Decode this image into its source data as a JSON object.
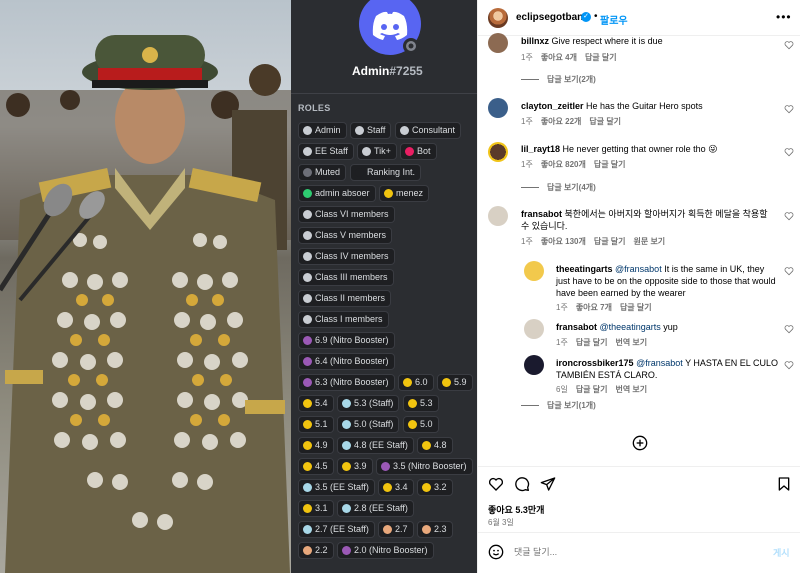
{
  "discord": {
    "username": "Admin",
    "discriminator": "#7255",
    "roles_title": "ROLES",
    "roles": [
      {
        "label": "Admin",
        "color": "#c9cdd3"
      },
      {
        "label": "Staff",
        "color": "#c9cdd3"
      },
      {
        "label": "Consultant",
        "color": "#c9cdd3"
      },
      {
        "label": "EE Staff",
        "color": "#c9cdd3"
      },
      {
        "label": "Tik+",
        "color": "#c9cdd3"
      },
      {
        "label": "Bot",
        "color": "#e91e63"
      },
      {
        "label": "Muted",
        "color": "#6d6f78"
      },
      {
        "label": "Ranking Int.",
        "color": "#1e1f22"
      },
      {
        "label": "admin absoer",
        "color": "#2ecc71"
      },
      {
        "label": "menez",
        "color": "#f1c40f"
      },
      {
        "label": "Class VI members",
        "color": "#c9cdd3"
      },
      {
        "label": "Class V members",
        "color": "#c9cdd3"
      },
      {
        "label": "Class IV members",
        "color": "#c9cdd3"
      },
      {
        "label": "Class III members",
        "color": "#c9cdd3"
      },
      {
        "label": "Class II members",
        "color": "#c9cdd3"
      },
      {
        "label": "Class I members",
        "color": "#c9cdd3"
      },
      {
        "label": "6.9 (Nitro Booster)",
        "color": "#9b59b6"
      },
      {
        "label": "6.4 (Nitro Booster)",
        "color": "#9b59b6"
      },
      {
        "label": "6.3 (Nitro Booster)",
        "color": "#9b59b6"
      },
      {
        "label": "6.0",
        "color": "#f1c40f"
      },
      {
        "label": "5.9",
        "color": "#f1c40f"
      },
      {
        "label": "5.4",
        "color": "#f1c40f"
      },
      {
        "label": "5.3 (Staff)",
        "color": "#a8d8e8"
      },
      {
        "label": "5.3",
        "color": "#f1c40f"
      },
      {
        "label": "5.1",
        "color": "#f1c40f"
      },
      {
        "label": "5.0 (Staff)",
        "color": "#a8d8e8"
      },
      {
        "label": "5.0",
        "color": "#f1c40f"
      },
      {
        "label": "4.9",
        "color": "#f1c40f"
      },
      {
        "label": "4.8 (EE Staff)",
        "color": "#a8d8e8"
      },
      {
        "label": "4.8",
        "color": "#f1c40f"
      },
      {
        "label": "4.5",
        "color": "#f1c40f"
      },
      {
        "label": "3.9",
        "color": "#f1c40f"
      },
      {
        "label": "3.5 (Nitro Booster)",
        "color": "#9b59b6"
      },
      {
        "label": "3.5 (EE Staff)",
        "color": "#a8d8e8"
      },
      {
        "label": "3.4",
        "color": "#f1c40f"
      },
      {
        "label": "3.2",
        "color": "#f1c40f"
      },
      {
        "label": "3.1",
        "color": "#f1c40f"
      },
      {
        "label": "2.8 (EE Staff)",
        "color": "#a8d8e8"
      },
      {
        "label": "2.7 (EE Staff)",
        "color": "#a8d8e8"
      },
      {
        "label": "2.7",
        "color": "#e8a87c"
      },
      {
        "label": "2.3",
        "color": "#e8a87c"
      },
      {
        "label": "2.2",
        "color": "#e8a87c"
      },
      {
        "label": "2.0 (Nitro Booster)",
        "color": "#9b59b6"
      }
    ]
  },
  "post": {
    "username": "eclipsegotban",
    "follow_label": "팔로우",
    "more_icon": "more-horizontal-icon"
  },
  "comments": [
    {
      "user": "billnxz",
      "text": "Give respect where it is due",
      "time": "1주",
      "likes": "좋아요 4개",
      "reply": "답글 달기",
      "view_replies": "답글 보기(2개)"
    },
    {
      "user": "clayton_zeitler",
      "text": "He has the Guitar Hero spots",
      "time": "1주",
      "likes": "좋아요 22개",
      "reply": "답글 달기"
    },
    {
      "user": "lil_rayt18",
      "text": "He never getting that owner role tho 😜",
      "time": "1주",
      "likes": "좋아요 820개",
      "reply": "답글 달기",
      "view_replies": "답글 보기(4개)"
    },
    {
      "user": "fransabot",
      "text": "북한에서는 아버지와 할아버지가 획득한 메달을 착용할 수 있습니다.",
      "time": "1주",
      "likes": "좋아요 130개",
      "reply": "답글 달기",
      "translate": "원문 보기"
    }
  ],
  "replies": [
    {
      "user": "theeatingarts",
      "mention": "@fransabot",
      "text": "It is the same in UK, they just have to be on the opposite side to those that would have been earned by the wearer",
      "time": "1주",
      "likes": "좋아요 7개",
      "reply": "답글 달기"
    },
    {
      "user": "fransabot",
      "mention": "@theeatingarts",
      "text": "yup",
      "time": "1주",
      "reply": "답글 달기",
      "translate": "번역 보기"
    },
    {
      "user": "ironcrossbiker175",
      "mention": "@fransabot",
      "text": "Y HASTA EN EL CULO TAMBIÉN ESTÁ CLARO.",
      "time": "6일",
      "reply": "답글 달기",
      "translate": "번역 보기"
    }
  ],
  "view_replies_last": "답글 보기(1개)",
  "footer": {
    "likes": "좋아요 5.3만개",
    "date": "6월 3일",
    "comment_placeholder": "댓글 달기...",
    "post_label": "게시"
  },
  "colors": {
    "accent": "#0095f6",
    "discord_bg": "#2b2d31",
    "discord_brand": "#5865f2"
  }
}
